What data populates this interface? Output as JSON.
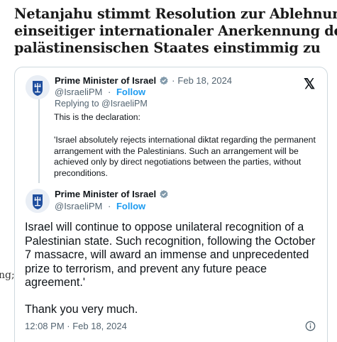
{
  "article": {
    "headline_lines": [
      "Netanjahu stimmt Resolution zur Ablehnung",
      "einseitiger internationaler Anerkennung des",
      "palästinensischen Staates einstimmig zu"
    ],
    "side_fragment": "ng;"
  },
  "embed": {
    "parent": {
      "author_name": "Prime Minister of Israel",
      "date": "Feb 18, 2024",
      "handle": "@IsraeliPM",
      "follow_label": "Follow",
      "replying_to": "Replying to @IsraeliPM",
      "text_intro": "This is the declaration:",
      "text_quote": "'Israel absolutely rejects international diktat regarding the permanent arrangement with the Palestinians. Such an arrangement will be achieved only by direct negotiations between the parties, without preconditions."
    },
    "reply": {
      "author_name": "Prime Minister of Israel",
      "handle": "@IsraeliPM",
      "follow_label": "Follow",
      "text_main": "Israel will continue to oppose unilateral recognition of a Palestinian state. Such recognition, following the October 7 massacre, will award an immense and unprecedented prize to terrorism, and prevent any future peace agreement.'",
      "text_thanks": "Thank you very much.",
      "timestamp": "12:08 PM · Feb 18, 2024"
    },
    "separator": "·",
    "x_logo": "𝕏"
  },
  "colors": {
    "accent_link": "#1d9bf0",
    "text_secondary": "#536471",
    "border": "#cfd9de"
  },
  "icons": [
    "israel-emblem-icon",
    "verified-badge-icon",
    "x-logo-icon",
    "info-icon"
  ]
}
